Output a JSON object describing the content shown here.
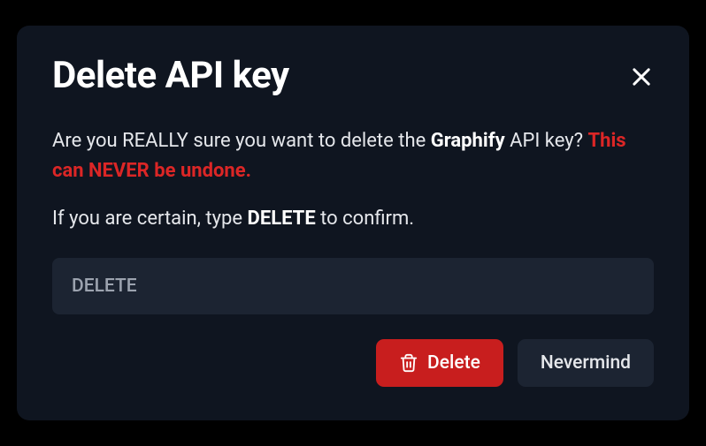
{
  "dialog": {
    "title": "Delete API key",
    "body": {
      "prefix": "Are you REALLY sure you want to delete the ",
      "key_name": "Graphify",
      "suffix": " API key? ",
      "warning": "This can NEVER be undone."
    },
    "confirm_prompt": {
      "prefix": "If you are certain, type ",
      "keyword": "DELETE",
      "suffix": " to confirm."
    },
    "input": {
      "placeholder": "DELETE",
      "value": ""
    },
    "buttons": {
      "delete": "Delete",
      "cancel": "Nevermind"
    }
  }
}
